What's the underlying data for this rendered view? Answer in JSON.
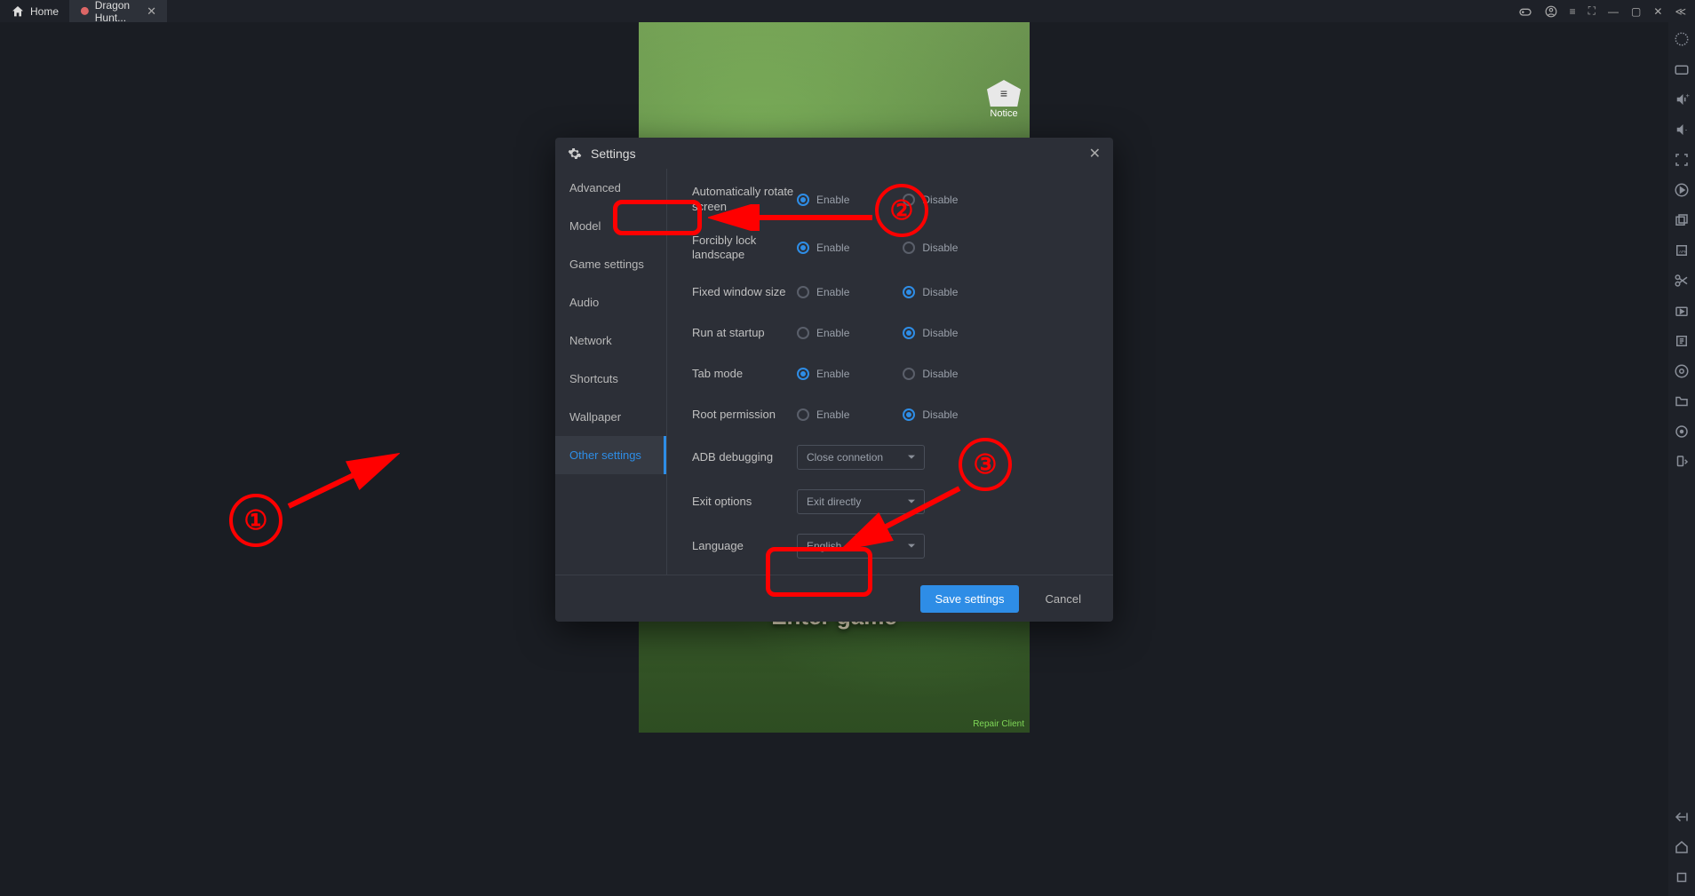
{
  "titlebar": {
    "home_label": "Home",
    "game_tab_label": "Dragon Hunt..."
  },
  "game": {
    "notice_label": "Notice",
    "enter_game_label": "Enter game",
    "repair_client_label": "Repair Client"
  },
  "modal": {
    "title": "Settings",
    "sidebar": [
      "Advanced",
      "Model",
      "Game settings",
      "Audio",
      "Network",
      "Shortcuts",
      "Wallpaper",
      "Other settings"
    ],
    "active_index": 7,
    "settings": {
      "auto_rotate": {
        "label": "Automatically rotate screen",
        "value": "Enable"
      },
      "force_lock": {
        "label": "Forcibly lock landscape",
        "value": "Enable"
      },
      "fixed_window": {
        "label": "Fixed window size",
        "value": "Disable"
      },
      "run_startup": {
        "label": "Run at startup",
        "value": "Disable"
      },
      "tab_mode": {
        "label": "Tab mode",
        "value": "Enable"
      },
      "root_perm": {
        "label": "Root permission",
        "value": "Disable"
      },
      "adb": {
        "label": "ADB debugging",
        "value": "Close connetion"
      },
      "exit": {
        "label": "Exit options",
        "value": "Exit directly"
      },
      "lang": {
        "label": "Language",
        "value": "English"
      }
    },
    "radio_labels": {
      "enable": "Enable",
      "disable": "Disable"
    },
    "buttons": {
      "save": "Save settings",
      "cancel": "Cancel"
    }
  },
  "annotations": {
    "one": "①",
    "two": "②",
    "three": "③"
  }
}
